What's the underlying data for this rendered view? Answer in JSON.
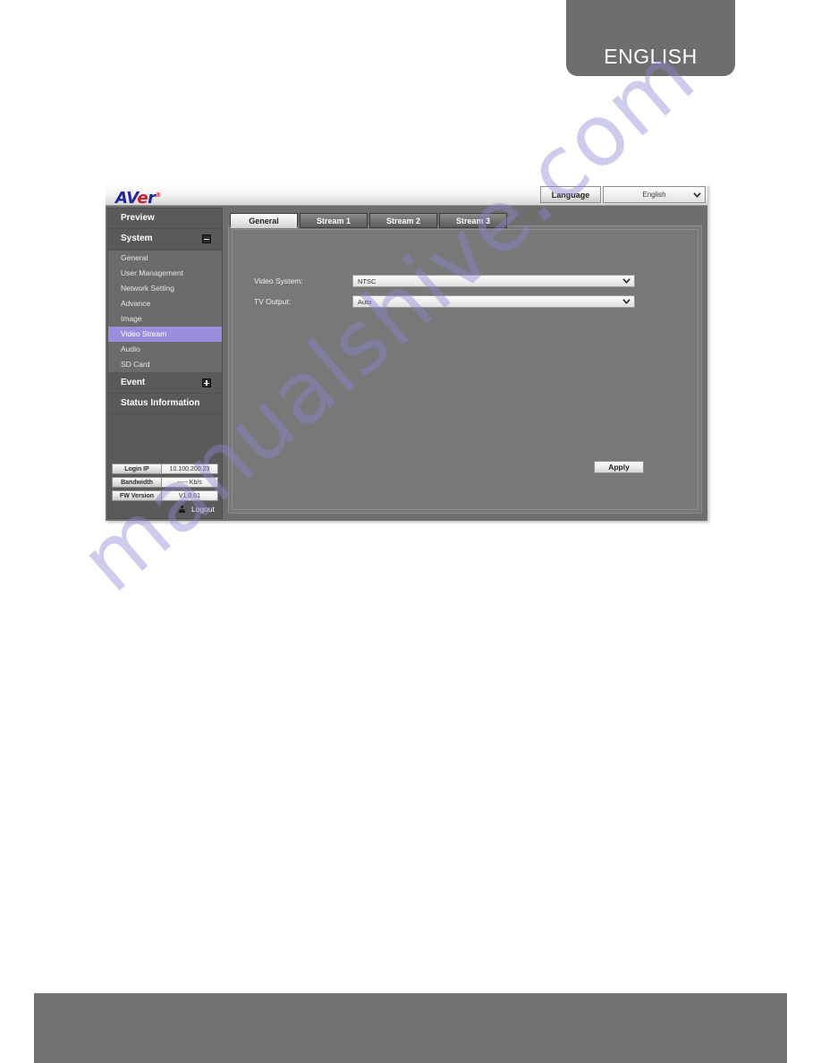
{
  "page": {
    "language_tab_label": "ENGLISH",
    "watermark": "manualshive.com"
  },
  "header": {
    "logo_a": "A",
    "logo_v": "V",
    "logo_e": "e",
    "logo_r": "r",
    "logo_tm": "®",
    "language_label": "Language",
    "language_value": "English",
    "chevron_icon": "chevron-down-icon"
  },
  "sidebar": {
    "groups": [
      {
        "label": "Preview",
        "toggle": null
      },
      {
        "label": "System",
        "toggle": "minus"
      }
    ],
    "system_items": [
      {
        "label": "General",
        "active": false
      },
      {
        "label": "User Management",
        "active": false
      },
      {
        "label": "Network Setting",
        "active": false
      },
      {
        "label": "Advance",
        "active": false
      },
      {
        "label": "Image",
        "active": false
      },
      {
        "label": "Video Stream",
        "active": true
      },
      {
        "label": "Audio",
        "active": false
      },
      {
        "label": "SD Card",
        "active": false
      }
    ],
    "lower_groups": [
      {
        "label": "Event",
        "toggle": "plus"
      },
      {
        "label": "Status Information",
        "toggle": null
      }
    ],
    "status": [
      {
        "key": "Login IP",
        "value": "10.100.200.23"
      },
      {
        "key": "Bandwidth",
        "value": "----- Kb/s"
      },
      {
        "key": "FW Version",
        "value": "V1.0.01"
      }
    ],
    "logout_label": "Logout",
    "logout_icon": "user-icon",
    "active_color": "#9b8ede"
  },
  "content": {
    "tabs": [
      {
        "label": "General",
        "active": true
      },
      {
        "label": "Stream 1",
        "active": false
      },
      {
        "label": "Stream 2",
        "active": false
      },
      {
        "label": "Stream 3",
        "active": false
      }
    ],
    "fields": [
      {
        "label": "Video System:",
        "value": "NTSC"
      },
      {
        "label": "TV Output:",
        "value": "Auto"
      }
    ],
    "apply_label": "Apply"
  }
}
